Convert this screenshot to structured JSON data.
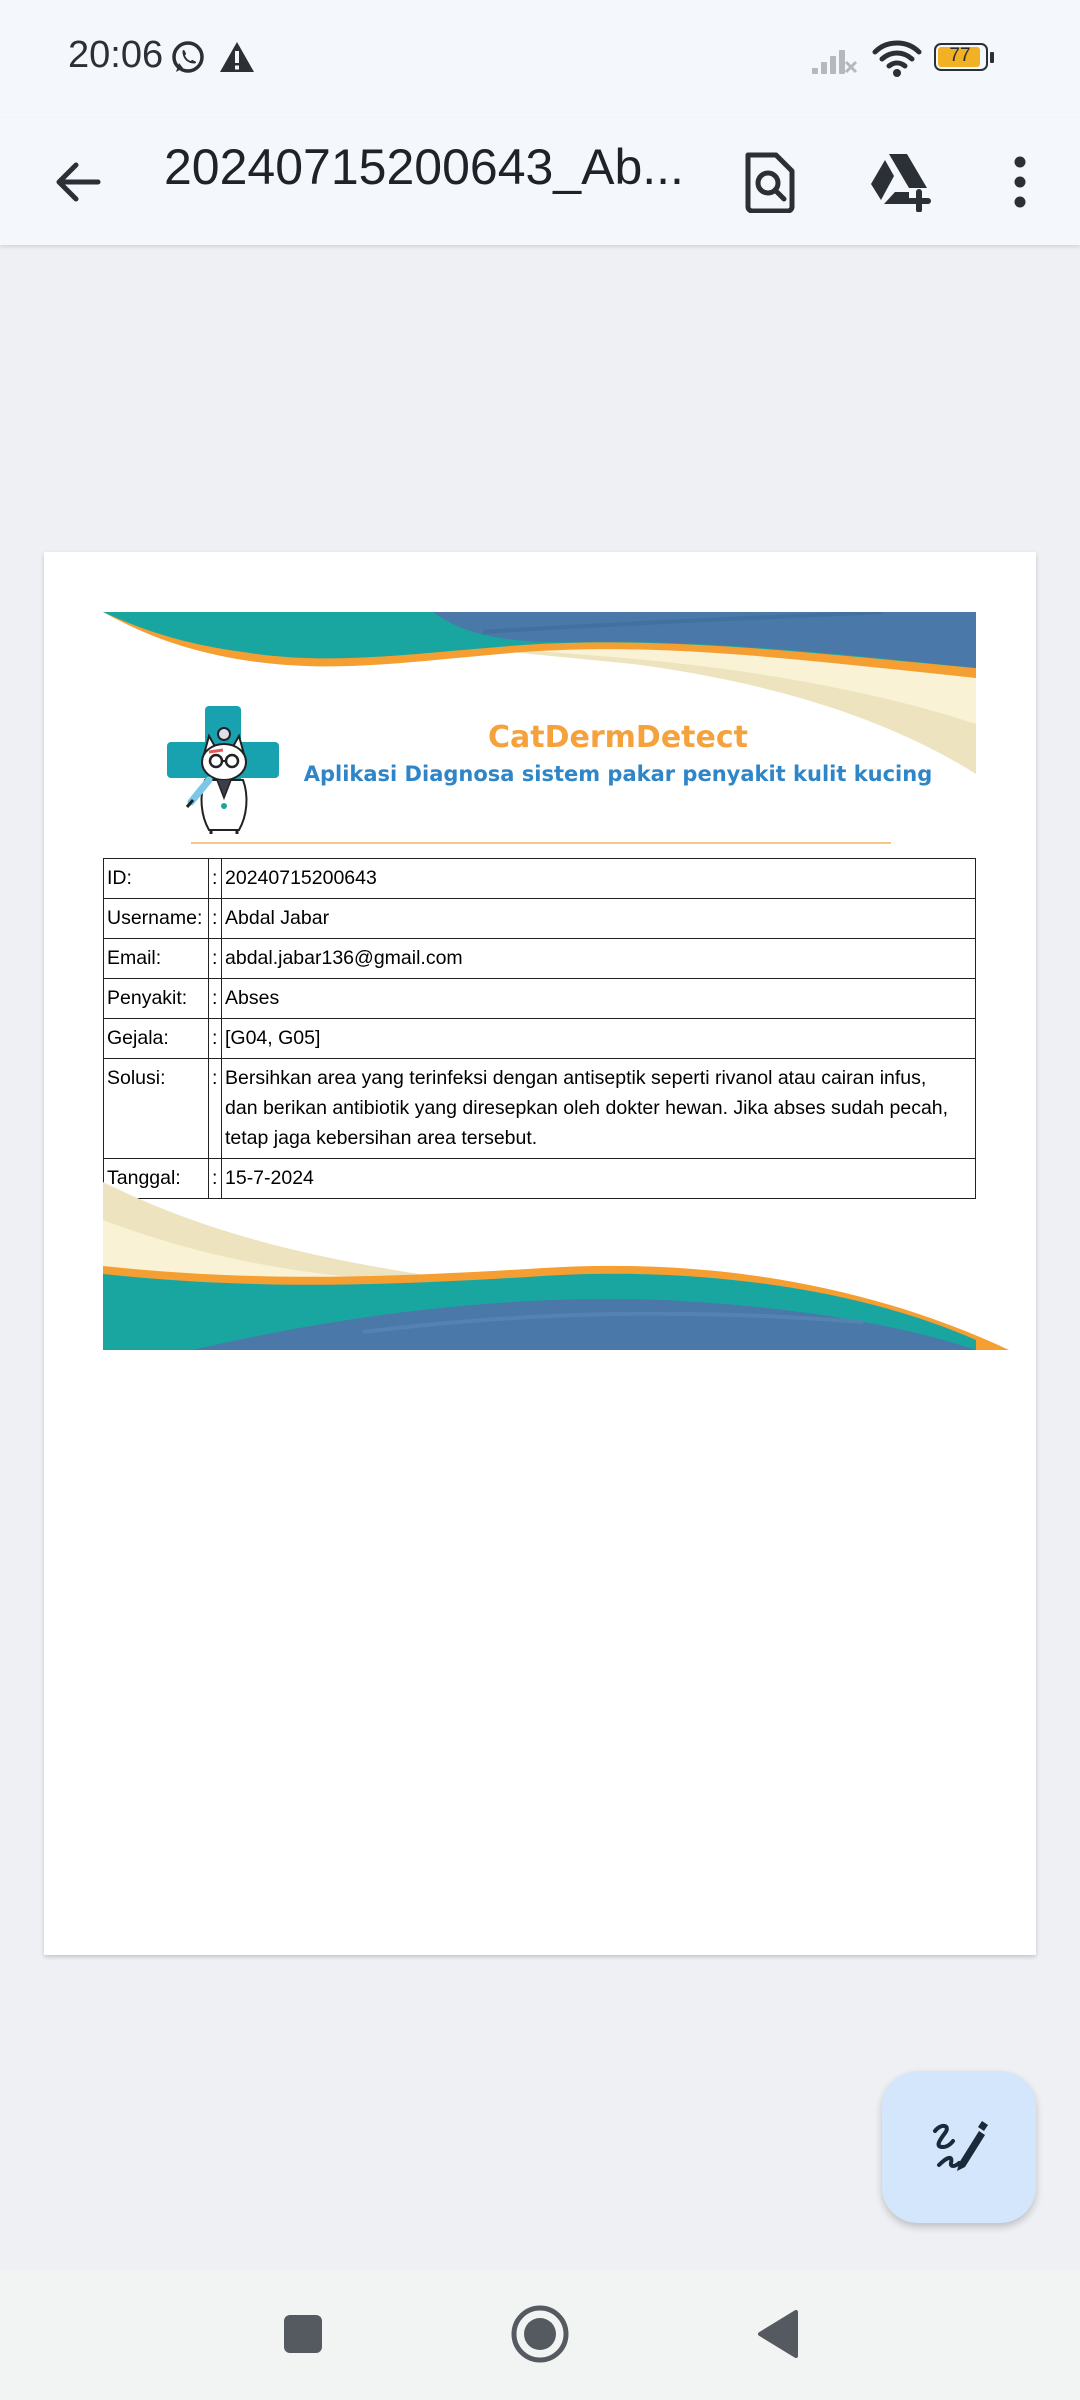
{
  "status_bar": {
    "time": "20:06",
    "battery_level": "77",
    "icons": [
      "whatsapp-icon",
      "alert-icon",
      "signal-icon",
      "wifi-icon",
      "battery-icon"
    ]
  },
  "app_bar": {
    "title": "20240715200643_Ab...",
    "icons": [
      "back-arrow-icon",
      "find-in-document-icon",
      "add-to-drive-icon",
      "more-options-icon"
    ]
  },
  "document": {
    "brand": {
      "name": "CatDermDetect",
      "tagline": "Aplikasi Diagnosa sistem pakar penyakit kulit kucing"
    },
    "colon": ":",
    "rows": [
      {
        "label": "ID:",
        "value": "20240715200643"
      },
      {
        "label": "Username:",
        "value": "Abdal Jabar"
      },
      {
        "label": "Email:",
        "value": "abdal.jabar136@gmail.com"
      },
      {
        "label": "Penyakit:",
        "value": "Abses"
      },
      {
        "label": "Gejala:",
        "value": "[G04, G05]"
      },
      {
        "label": "Solusi:",
        "value_lines": [
          "Bersihkan area yang terinfeksi dengan antiseptik seperti rivanol atau cairan infus,",
          "dan berikan antibiotik yang diresepkan oleh dokter hewan. Jika abses sudah pecah,",
          "tetap jaga kebersihan area tersebut."
        ]
      },
      {
        "label": "Tanggal:",
        "value": "15-7-2024"
      }
    ]
  },
  "fab": {
    "icon": "signature-pen-icon"
  },
  "nav_bar": {
    "icons": [
      "recents-square-icon",
      "home-circle-icon",
      "back-triangle-icon"
    ]
  },
  "colors": {
    "teal": "#1aa6a0",
    "blue": "#4a78a8",
    "orange": "#f59e32",
    "cream": "#ede3bf",
    "brand_orange": "#f5a23c",
    "brand_blue": "#2e86c8",
    "fab_bg": "#d3e6fb"
  }
}
